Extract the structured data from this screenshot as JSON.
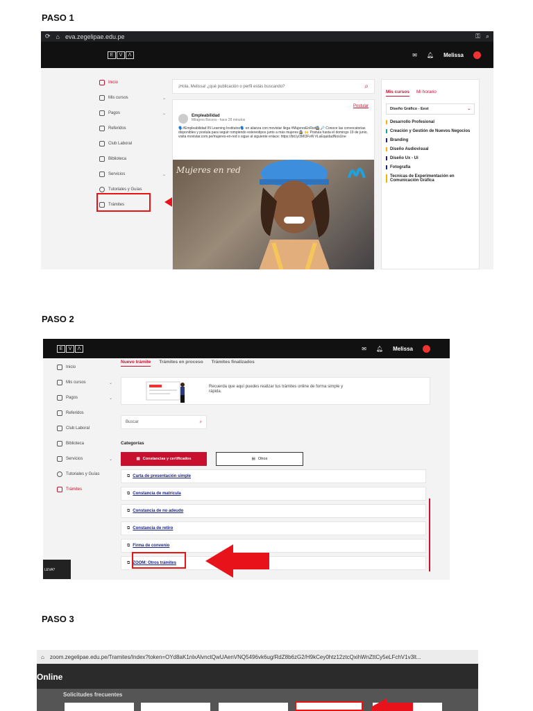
{
  "steps": {
    "step1": "PASO 1",
    "step2": "PASO 2",
    "step3": "PASO 3"
  },
  "step1": {
    "browser_url": "eva.zegelipae.edu.pe",
    "user_name": "Melissa",
    "logo_letters": [
      "E",
      "V",
      "Λ"
    ],
    "sidebar": [
      "Inicio",
      "Mis cursos",
      "Pagos",
      "Referidos",
      "Club Laboral",
      "Biblioteca",
      "Servicios",
      "Tutoriales y Guías",
      "Trámites"
    ],
    "search_placeholder": "¡Hola, Melissa! ¿qué publicación o perfil estás buscando?",
    "postular": "Postular",
    "post_author": "Empleabilidad",
    "post_meta": "Milagros Bocera - hace 28 minutos",
    "post_text": "🗣️#Empleabilidad IN Learning Institutos🗣️ en alianza con movistar llega #MujeresEnRed👩‍🔧🔎 Conoce las convocatorias disponibles y postula para seguir rompiendo estereotipos junto a más mujeres 👩‍🔧 🙌 Postula hasta el domingo 19 de junio, visita movistar.com.pe/mujeres-en-red o sigue al siguiente enlace: https://bit.ly/3MI3FvW #LaEquidadNosUne",
    "photo_overlay": "Mujeres en red",
    "tabs": [
      "Mis cursos",
      "Mi horario"
    ],
    "career_select": "Diseño Gráfico - Eest",
    "courses": [
      "Desarrollo Profesional",
      "Creación y Gestión de Nuevos Negocios",
      "Branding",
      "Diseño Audiovisual",
      "Diseño Ux - Ui",
      "Fotografía",
      "Tecnicas de Experimentación en Comunicación Gráfica"
    ],
    "course_colors": [
      "#f5b400",
      "#1aa39a",
      "#1a237e",
      "#f5b400",
      "#1a237e",
      "#1a237e",
      "#f5b400"
    ]
  },
  "step2": {
    "user_name": "Melissa",
    "sidebar": [
      "Inicio",
      "Mis cursos",
      "Pagos",
      "Referidos",
      "Club Laboral",
      "Biblioteca",
      "Servicios",
      "Tutoriales y Guías",
      "Trámites"
    ],
    "tabs": [
      "Nuevo trámite",
      "Trámites en proceso",
      "Trámites finalizados"
    ],
    "banner_text": "Recuerda que aquí puedes realizar tus trámites online de forma simple y rápida.",
    "search_placeholder": "Buscar",
    "categories_label": "Categorías",
    "category_buttons": [
      "Constancias y certificados",
      "Otros"
    ],
    "items": [
      "Carta de presentación simple",
      "Constancia de matrícula",
      "Constancia de no adeudo",
      "Constancia de retiro",
      "Firma de convenio",
      "ZOOM: Otros trámites"
    ],
    "corner_text": "LEVA?"
  },
  "step3": {
    "browser_url": "zoom.zegelipae.edu.pe/Tramites/Index?token=OYd8aK1nlxAlvnctQwUAenVNQ5496vk6ug/RdZ8b6zG2/H9kCey0htz12ztcQxihWnZttCy5eLFchV1v3lt...",
    "heading": "Online",
    "subheading": "Solicitudes frecuentes"
  }
}
